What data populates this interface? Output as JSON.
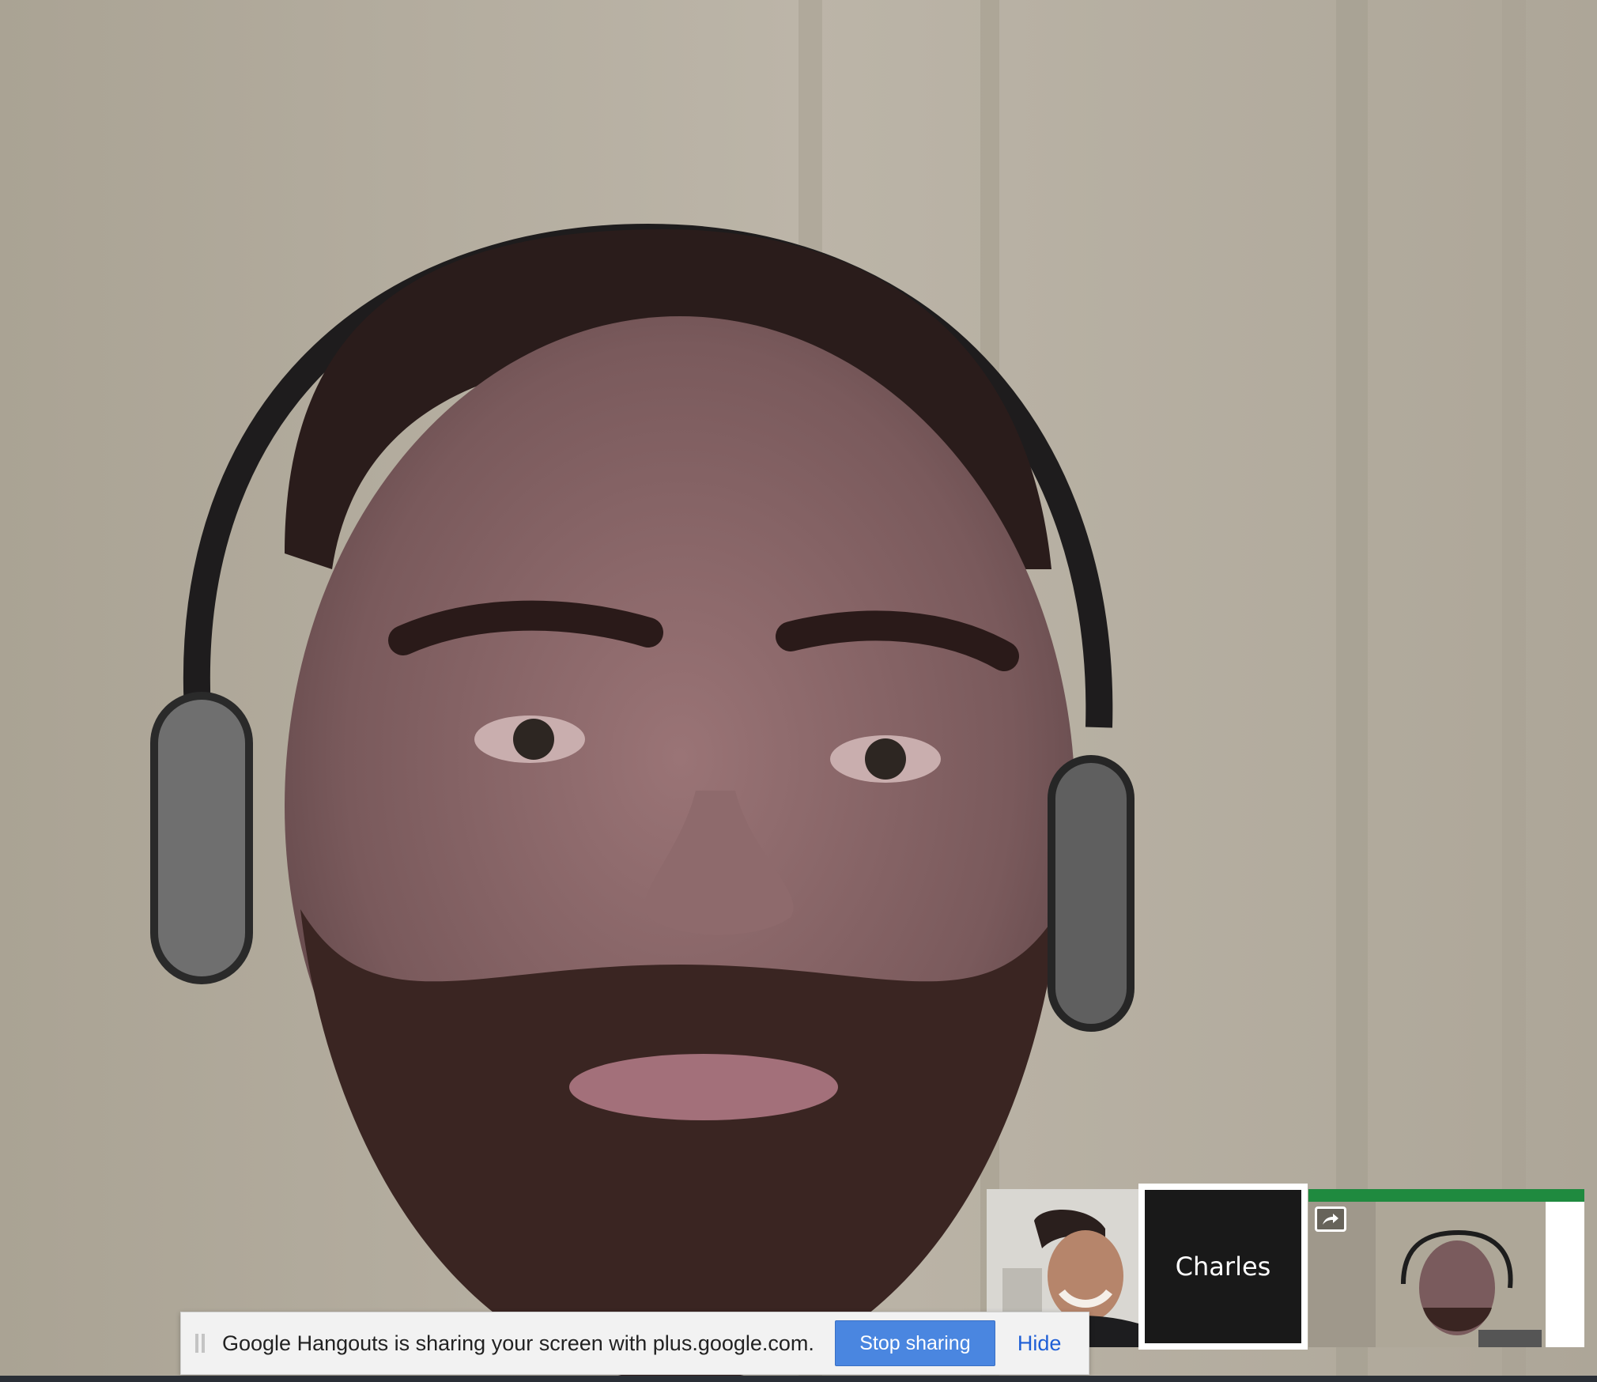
{
  "share_bar": {
    "message": "Google Hangouts is sharing your screen with plus.google.com.",
    "stop_label": "Stop sharing",
    "hide_label": "Hide"
  },
  "participants": [
    {
      "name": "",
      "type": "video",
      "icon": "person-smiling"
    },
    {
      "name": "Charles",
      "type": "avatar-name",
      "selected": true
    },
    {
      "name": "",
      "type": "screen-share-preview",
      "icon": "share-arrow-icon"
    }
  ],
  "colors": {
    "stop_button": "#4a86e0",
    "hide_link": "#1f5fd6",
    "share_bar_bg": "#f2f2f2"
  }
}
